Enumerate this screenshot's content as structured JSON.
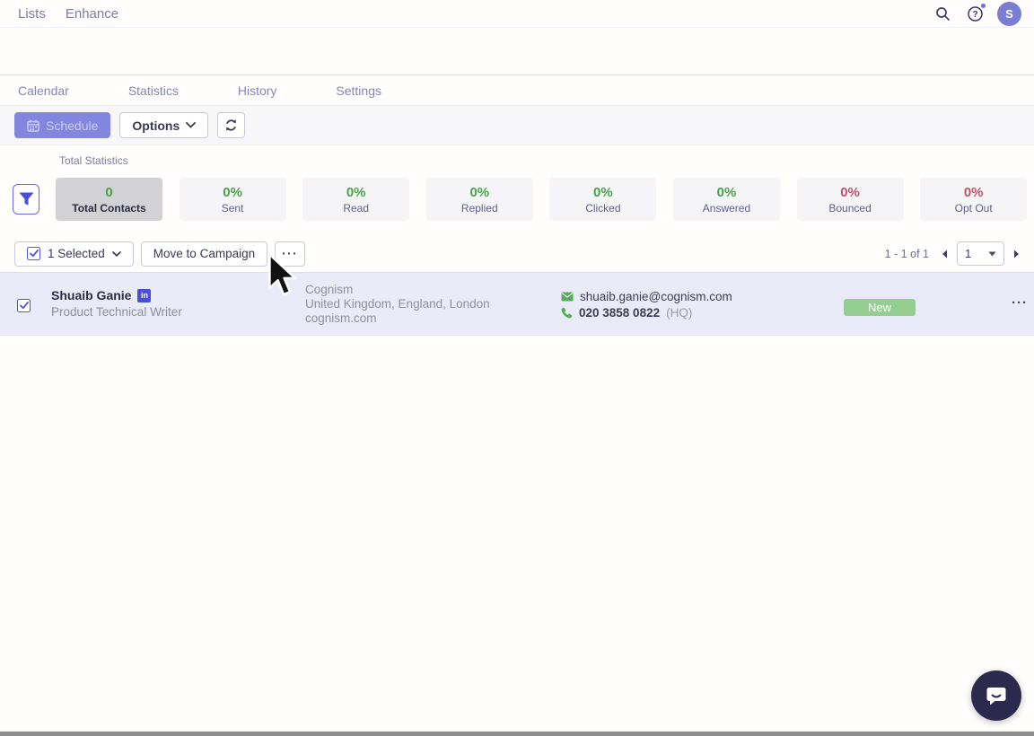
{
  "topnav": {
    "items": [
      {
        "label": "Lists"
      },
      {
        "label": "Enhance"
      }
    ],
    "avatar_initial": "S"
  },
  "tabs": [
    {
      "label": "Calendar"
    },
    {
      "label": "Statistics"
    },
    {
      "label": "History"
    },
    {
      "label": "Settings"
    }
  ],
  "toolbar": {
    "schedule_label": "Schedule",
    "options_label": "Options"
  },
  "stats": {
    "section_label": "Total Statistics",
    "cards": [
      {
        "value": "0",
        "label": "Total Contacts",
        "value_color": "#47a347",
        "selected": true
      },
      {
        "value": "0%",
        "label": "Sent",
        "value_color": "#47a347"
      },
      {
        "value": "0%",
        "label": "Read",
        "value_color": "#47a347"
      },
      {
        "value": "0%",
        "label": "Replied",
        "value_color": "#47a347"
      },
      {
        "value": "0%",
        "label": "Clicked",
        "value_color": "#47a347"
      },
      {
        "value": "0%",
        "label": "Answered",
        "value_color": "#47a347"
      },
      {
        "value": "0%",
        "label": "Bounced",
        "value_color": "#c4506a"
      },
      {
        "value": "0%",
        "label": "Opt Out",
        "value_color": "#c4506a"
      }
    ]
  },
  "selection_bar": {
    "selected_label": "1 Selected",
    "move_to_campaign_label": "Move to Campaign",
    "more_label": "···",
    "pagination": {
      "range": "1 - 1 of 1",
      "page": "1"
    }
  },
  "contact": {
    "name": "Shuaib Ganie",
    "title": "Product Technical Writer",
    "company": "Cognism",
    "location": "United Kingdom, England, London",
    "website": "cognism.com",
    "email": "shuaib.ganie@cognism.com",
    "phone": "020 3858 0822",
    "phone_suffix": "(HQ)",
    "status": "New",
    "more_label": "···",
    "linkedin_label": "in"
  },
  "colors": {
    "accent_purple": "#8286de",
    "green": "#47a347",
    "red": "#c4506a",
    "row_background": "#e9ecf8",
    "badge_green": "#94ce90",
    "chat_navy": "#2b2a4e"
  },
  "icons": {
    "search": "magnifier",
    "help": "question-circle-with-dot",
    "calendar": "calendar-grid",
    "refresh": "circular-arrows",
    "filter": "funnel",
    "chevron_down": "chevron-down",
    "linkedin": "in-square",
    "email": "envelope",
    "phone": "handset",
    "chat": "speech-bubble-smile"
  }
}
